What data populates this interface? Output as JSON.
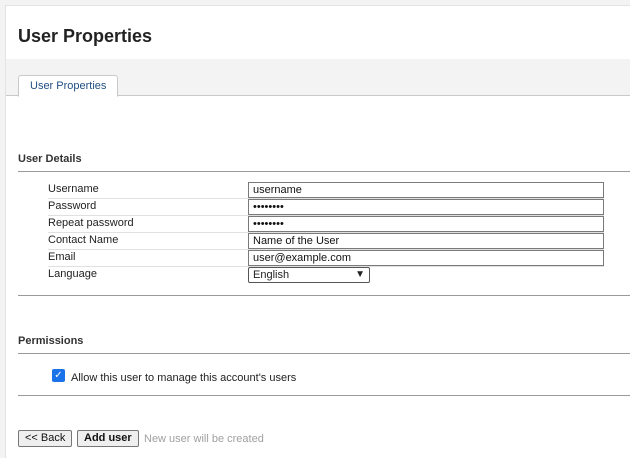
{
  "page": {
    "title": "User Properties"
  },
  "tabs": [
    {
      "label": "User Properties"
    }
  ],
  "user_details": {
    "heading": "User Details",
    "fields": [
      {
        "label": "Username",
        "value": "username",
        "type": "text"
      },
      {
        "label": "Password",
        "value": "••••••••",
        "type": "password"
      },
      {
        "label": "Repeat password",
        "value": "••••••••",
        "type": "password"
      },
      {
        "label": "Contact Name",
        "value": "Name of the User",
        "type": "text"
      },
      {
        "label": "Email",
        "value": "user@example.com",
        "type": "text"
      }
    ],
    "language": {
      "label": "Language",
      "selected": "English"
    }
  },
  "permissions": {
    "heading": "Permissions",
    "manage_users": {
      "label": "Allow this user to manage this account's users",
      "checked": true
    }
  },
  "actions": {
    "back_label": "<< Back",
    "add_label": "Add user",
    "hint": "New user will be created"
  },
  "colors": {
    "accent": "#1a73e8",
    "tab_text": "#1f4e82",
    "hint": "#a0a0a0"
  }
}
